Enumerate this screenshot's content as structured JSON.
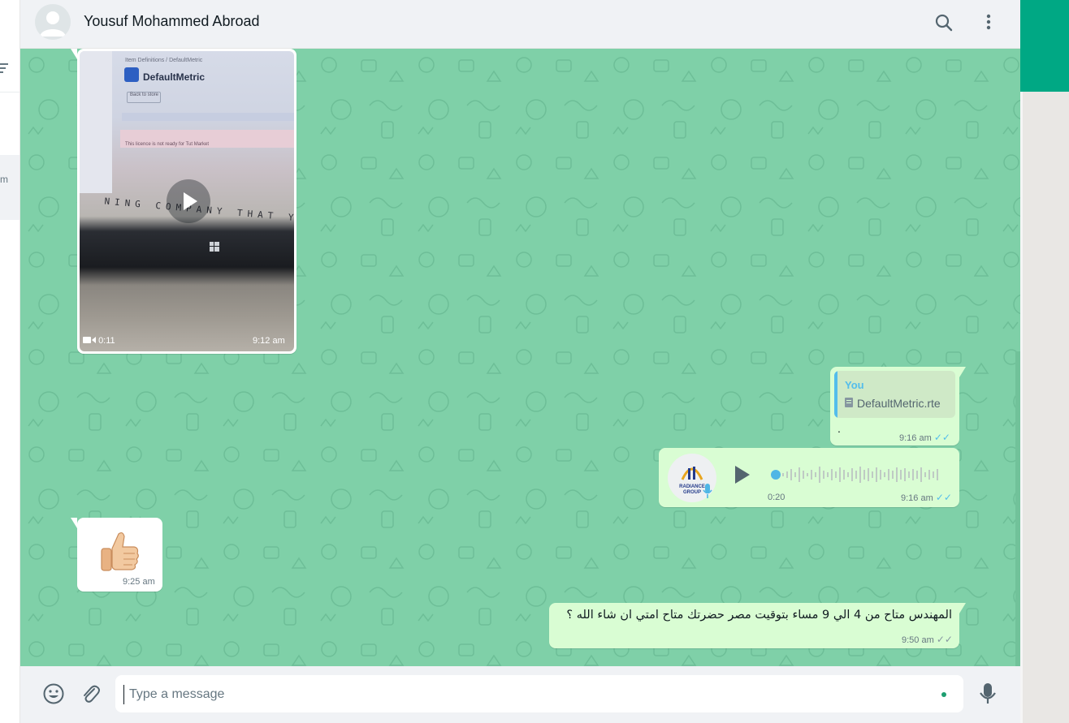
{
  "header": {
    "contact_name": "Yousuf Mohammed Abroad",
    "search_icon": "search-icon",
    "menu_icon": "more-vertical-icon"
  },
  "sidebar": {
    "partial_text": "m"
  },
  "messages": [
    {
      "id": "video",
      "direction": "incoming",
      "type": "video",
      "duration": "0:11",
      "time": "9:12 am",
      "thumbnail_text": {
        "breadcrumb": "Item Definitions / DefaultMetric",
        "brand": "DefaultMetric",
        "button": "Back to store",
        "notice": "This licence is not ready for Tut Market",
        "caption": "NING COMPANY THAT YOU"
      }
    },
    {
      "id": "doc-reply",
      "direction": "outgoing",
      "type": "reply",
      "quote_author": "You",
      "quote_file": "DefaultMetric.rte",
      "body": ".",
      "time": "9:16 am",
      "ticks": "✓✓"
    },
    {
      "id": "voice",
      "direction": "outgoing",
      "type": "voice",
      "avatar_label": "RADIANCE GROUP",
      "duration": "0:20",
      "progress": 0,
      "time": "9:16 am",
      "ticks": "✓✓"
    },
    {
      "id": "thumbs",
      "direction": "incoming",
      "type": "emoji",
      "emoji": "thumbs-up",
      "time": "9:25 am"
    },
    {
      "id": "arabic",
      "direction": "outgoing",
      "type": "text",
      "body": "المهندس متاح من 4 الي 9 مساء بتوقيت مصر حضرتك متاح امتي ان شاء الله ؟",
      "time": "9:50 am",
      "ticks": "✓✓"
    }
  ],
  "composer": {
    "placeholder": "Type a message",
    "emoji_icon": "emoji-icon",
    "attach_icon": "paperclip-icon",
    "mic_icon": "microphone-icon"
  },
  "colors": {
    "accent": "#00a884",
    "chat_background": "#7fd0a8",
    "outgoing_bubble": "#d9fdd3",
    "incoming_bubble": "#ffffff",
    "read_ticks": "#53bdeb"
  }
}
